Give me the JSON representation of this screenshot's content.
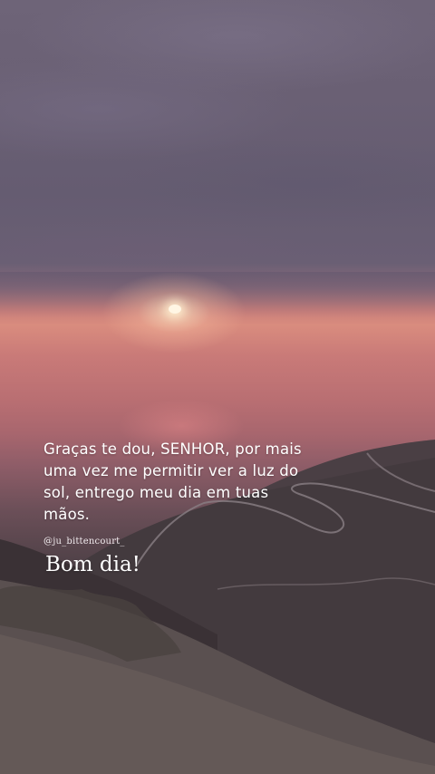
{
  "post": {
    "message": "Graças te dou, SENHOR, por mais uma vez me permitir ver a luz do sol, entrego meu dia em tuas mãos.",
    "handle": "@ju_bittencourt_",
    "greeting": "Bom dia!"
  },
  "scene": {
    "subject": "sunset over the sea with mountain hillside and winding road",
    "colors": {
      "sky": "#6a6074",
      "horizon": "#d98c7e",
      "sea": "#b86e72",
      "hill": "#3e3538",
      "text": "#ffffff"
    }
  }
}
